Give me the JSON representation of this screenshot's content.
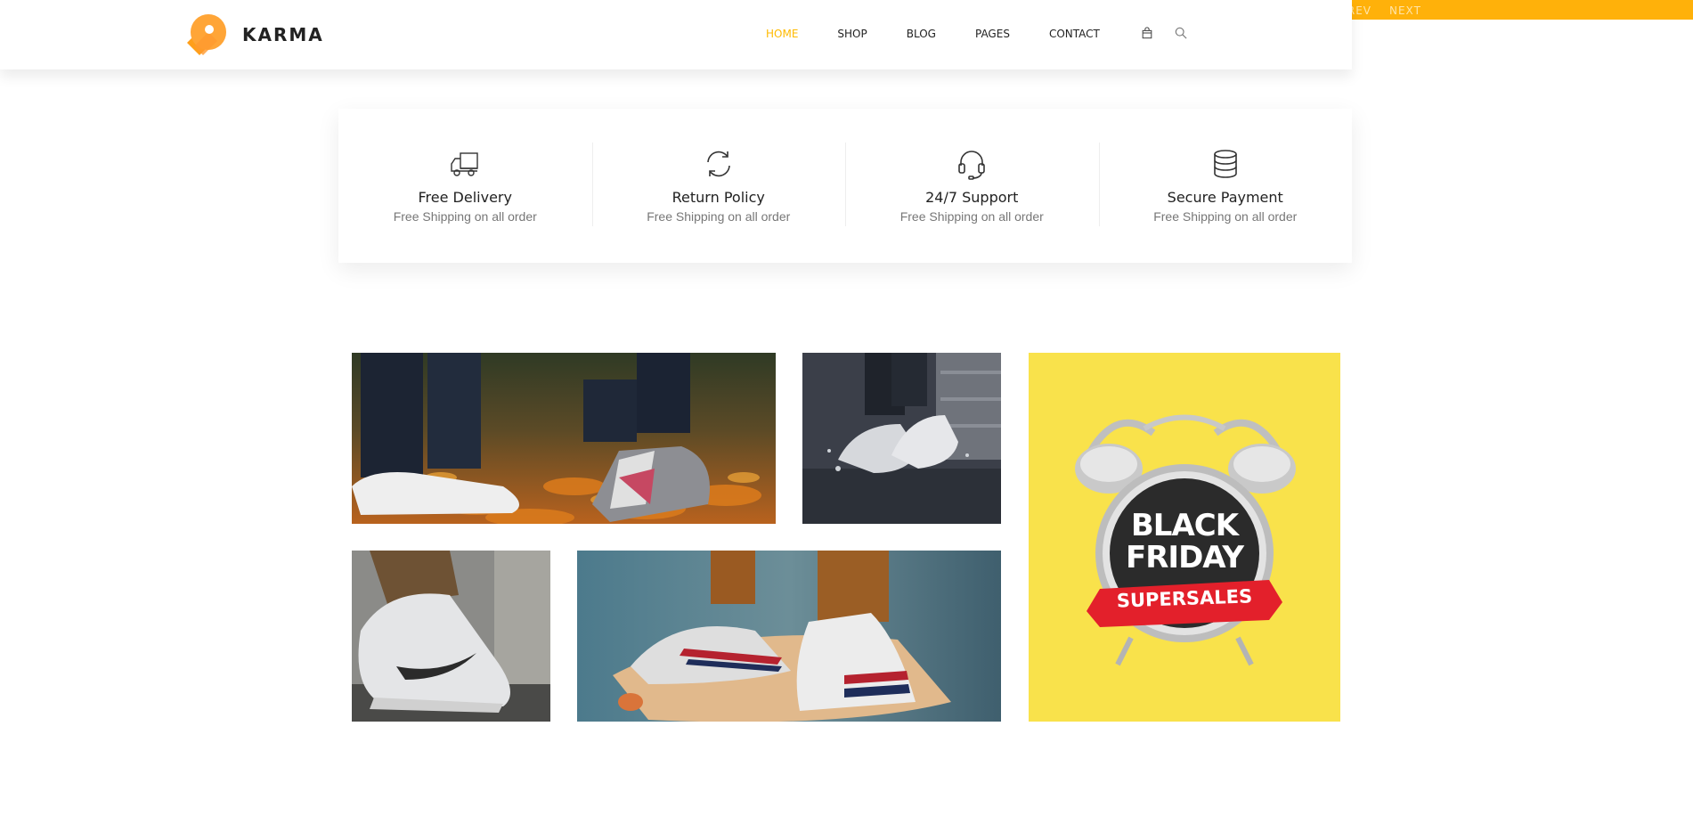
{
  "top_strip": {
    "prev_label": "PREV",
    "next_label": "NEXT",
    "color": "#ffb10a"
  },
  "brand": {
    "name": "KARMA",
    "accent": "#ffba00"
  },
  "nav": {
    "items": [
      {
        "label": "HOME",
        "active": true
      },
      {
        "label": "SHOP"
      },
      {
        "label": "BLOG"
      },
      {
        "label": "PAGES"
      },
      {
        "label": "CONTACT"
      }
    ],
    "icons": [
      "shopping-bag-icon",
      "search-icon"
    ]
  },
  "features": [
    {
      "icon": "truck-icon",
      "title": "Free Delivery",
      "subtitle": "Free Shipping on all order"
    },
    {
      "icon": "refresh-icon",
      "title": "Return Policy",
      "subtitle": "Free Shipping on all order"
    },
    {
      "icon": "headset-icon",
      "title": "24/7 Support",
      "subtitle": "Free Shipping on all order"
    },
    {
      "icon": "database-icon",
      "title": "Secure Payment",
      "subtitle": "Free Shipping on all order"
    }
  ],
  "promo": {
    "line1": "BLACK",
    "line2": "FRIDAY",
    "banner": "SUPERSALES",
    "background": "#f9e24b",
    "banner_color": "#e3202b"
  }
}
